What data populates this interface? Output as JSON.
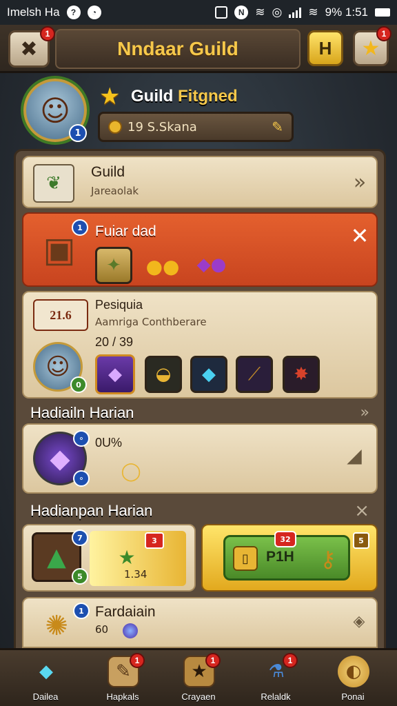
{
  "status_bar": {
    "carrier": "Imelsh Ha",
    "battery": "9% 1:51"
  },
  "header": {
    "title": "Nndaar Guild",
    "back_badge": "1",
    "h_button": "H",
    "star_badge": "1"
  },
  "profile": {
    "name": "Guild",
    "name_accent": "Fitgned",
    "points": "19 S.Skana",
    "level": "1"
  },
  "cards": {
    "guild": {
      "title": "Guild",
      "subtitle": "Jareaolak"
    },
    "featured": {
      "title": "Fuiar dad",
      "badge": "1"
    },
    "pesiquia": {
      "tag": "21.6",
      "title": "Pesiquia",
      "subtitle": "Aamriga Conthberare",
      "count": "20 / 39",
      "badge": "0"
    }
  },
  "sections": {
    "daily": {
      "title": "Hadiailn Harian",
      "percent": "0U%",
      "chevron": "»"
    },
    "daily2": {
      "title": "Hadianpan Harian",
      "close": "×",
      "left_badge": "7",
      "left_red_badge": "3",
      "left_count": "1.34",
      "left_small": "5",
      "right_badge": "32",
      "right_button": "P1H",
      "right_corner": "5"
    },
    "fardaiain": {
      "title": "Fardaiain",
      "value": "60",
      "badge": "1"
    }
  },
  "bottom_nav": [
    {
      "label": "Dailea",
      "icon": "crystal-icon",
      "badge": ""
    },
    {
      "label": "Hapkals",
      "icon": "scroll-icon",
      "badge": "1"
    },
    {
      "label": "Crayaen",
      "icon": "chest-icon",
      "badge": "1"
    },
    {
      "label": "Relaldk",
      "icon": "potion-icon",
      "badge": "1"
    },
    {
      "label": "Ponai",
      "icon": "bread-icon",
      "badge": ""
    }
  ],
  "colors": {
    "accent_gold": "#f6c84a",
    "featured_red": "#d8522a",
    "daily_green": "#5f9a3a"
  }
}
